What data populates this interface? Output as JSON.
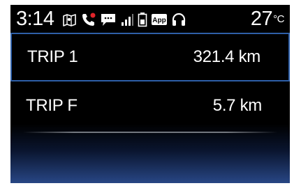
{
  "status_bar": {
    "time": "3:14",
    "temperature_value": "27",
    "temperature_unit": "°C",
    "icons": [
      "map-icon",
      "phone-missed-icon",
      "message-icon",
      "signal-bars-icon",
      "battery-icon",
      "app-icon",
      "headphones-icon"
    ],
    "app_badge": "App"
  },
  "trips": [
    {
      "label": "TRIP 1",
      "value": "321.4 km",
      "selected": true
    },
    {
      "label": "TRIP F",
      "value": "5.7 km",
      "selected": false
    }
  ],
  "colors": {
    "background": "#000000",
    "text": "#ffffff",
    "selection_border": "#2e5fa8",
    "missed_call": "#e0242a",
    "bottom_glow": "#2a4a8c"
  }
}
